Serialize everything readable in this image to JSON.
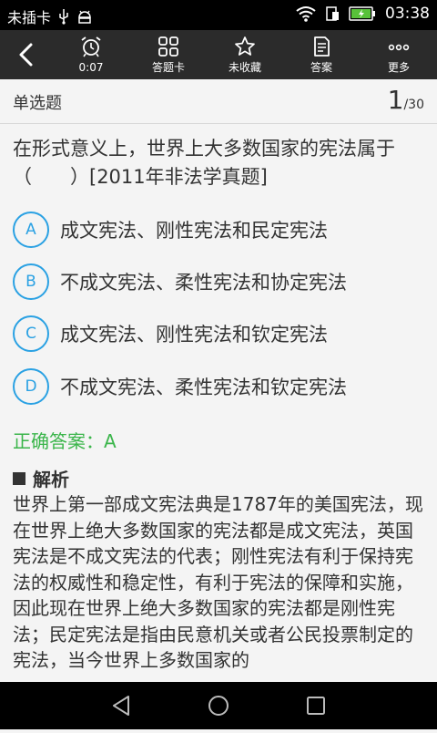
{
  "status_bar": {
    "carrier": "未插卡",
    "time": "03:38"
  },
  "toolbar": {
    "timer_label": "0:07",
    "card_label": "答题卡",
    "favorite_label": "未收藏",
    "answer_label": "答案",
    "more_label": "更多"
  },
  "question_header": {
    "type": "单选题",
    "current": "1",
    "total": "/30"
  },
  "question": {
    "text": "在形式意义上，世界上大多数国家的宪法属于（　　）[2011年非法学真题]"
  },
  "options": [
    {
      "letter": "A",
      "text": "成文宪法、刚性宪法和民定宪法"
    },
    {
      "letter": "B",
      "text": "不成文宪法、柔性宪法和协定宪法"
    },
    {
      "letter": "C",
      "text": "成文宪法、刚性宪法和钦定宪法"
    },
    {
      "letter": "D",
      "text": "不成文宪法、柔性宪法和钦定宪法"
    }
  ],
  "answer": {
    "text": "正确答案：A"
  },
  "analysis": {
    "title": "解析",
    "text": "世界上第一部成文宪法典是1787年的美国宪法，现在世界上绝大多数国家的宪法都是成文宪法，英国宪法是不成文宪法的代表；刚性宪法有利于保持宪法的权威性和稳定性，有利于宪法的保障和实施，因此现在世界上绝大多数国家的宪法都是刚性宪法；民定宪法是指由民意机关或者公民投票制定的宪法，当今世界上多数国家的"
  },
  "colors": {
    "accent": "#2aa1e3",
    "correct": "#3ab54a",
    "toolbar_bg": "#2b2b2b"
  }
}
